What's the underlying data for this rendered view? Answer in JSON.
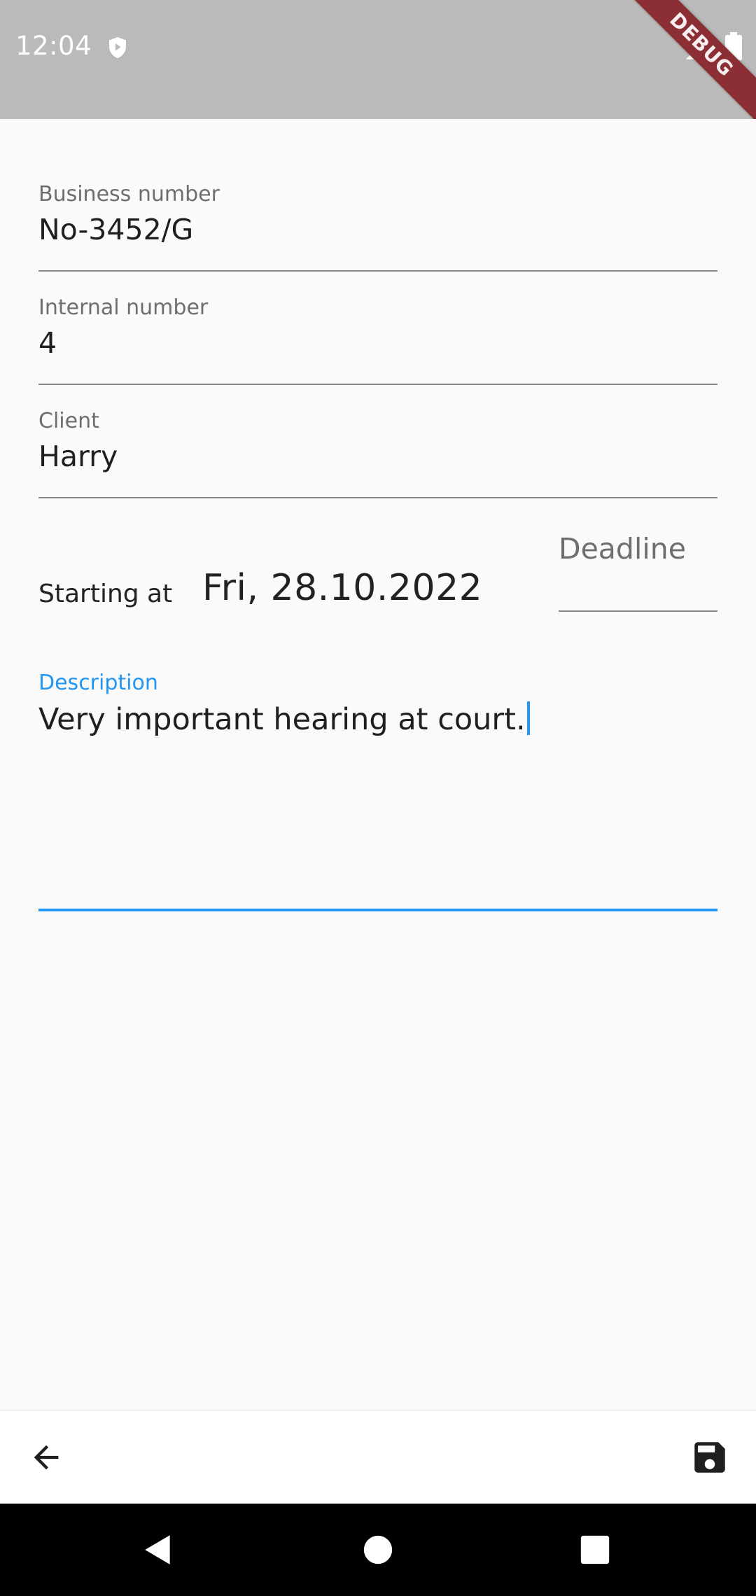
{
  "status_bar": {
    "time": "12:04",
    "debug_label": "DEBUG"
  },
  "form": {
    "business_number": {
      "label": "Business number",
      "value": "No-3452/G"
    },
    "internal_number": {
      "label": "Internal number",
      "value": "4"
    },
    "client": {
      "label": "Client",
      "value": "Harry"
    },
    "starting_at": {
      "label": "Starting at",
      "date": "Fri, 28.10.2022"
    },
    "deadline": {
      "placeholder": "Deadline"
    },
    "description": {
      "label": "Description",
      "value": "Very important hearing at court."
    }
  },
  "colors": {
    "accent": "#2196f3",
    "status_bar": "#bababa",
    "debug_banner": "#8b2f34"
  },
  "icons": {
    "status": [
      "shield-icon",
      "signal-icon",
      "battery-icon"
    ],
    "bottom_bar": [
      "arrow-back-icon",
      "save-icon"
    ],
    "nav": [
      "nav-back-icon",
      "nav-home-icon",
      "nav-recents-icon"
    ]
  }
}
